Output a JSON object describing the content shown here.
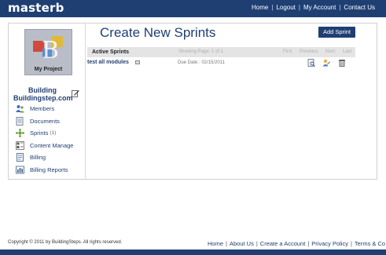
{
  "header": {
    "logo": "masterb",
    "nav": [
      "Home",
      "Logout",
      "My Account",
      "Contact Us"
    ]
  },
  "project": {
    "tile_label": "My Project",
    "name_line1": "Building",
    "name_line2": "Buildingstep.com"
  },
  "sidebar": {
    "items": [
      {
        "label": "Members",
        "icon": "members-icon"
      },
      {
        "label": "Documents",
        "icon": "documents-icon"
      },
      {
        "label": "Sprints",
        "count": "(1)",
        "icon": "sprints-icon"
      },
      {
        "label": "Content Manage",
        "icon": "content-manage-icon"
      },
      {
        "label": "Billing",
        "icon": "billing-icon"
      },
      {
        "label": "Billing Reports",
        "icon": "billing-reports-icon"
      }
    ]
  },
  "main": {
    "title": "Create New Sprints",
    "add_button": "Add Sprint",
    "table_header": {
      "title": "Active Sprints",
      "showing": "Showing Page: 1 of 1",
      "first": "First",
      "previous": "Previous",
      "next": "Next",
      "last": "Last"
    },
    "rows": [
      {
        "name": "test all modules",
        "due": "Due Date : 02/15/2011"
      }
    ]
  },
  "footer": {
    "copyright": "Copyright © 2011 by BuildingSteps. All rights reserved.",
    "links": [
      "Home",
      "About Us",
      "Create a Account",
      "Privacy Policy",
      "Terms & Co"
    ]
  },
  "colors": {
    "brand": "#1f3f73",
    "header_row": "#e4e4e4"
  }
}
